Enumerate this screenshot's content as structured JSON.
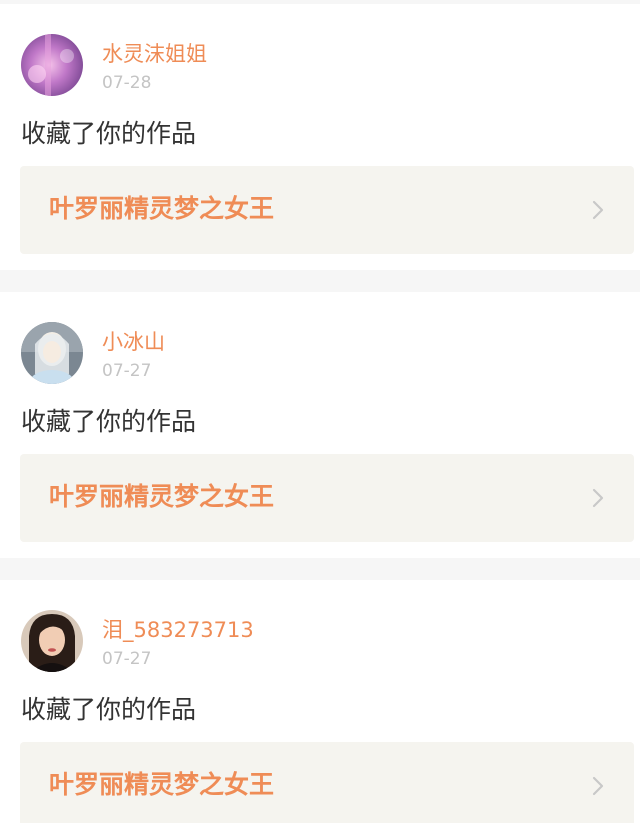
{
  "notifications": [
    {
      "username": "水灵沫姐姐",
      "date": "07-28",
      "action": "收藏了你的作品",
      "work_title": "叶罗丽精灵梦之女王"
    },
    {
      "username": "小冰山",
      "date": "07-27",
      "action": "收藏了你的作品",
      "work_title": "叶罗丽精灵梦之女王"
    },
    {
      "username": "泪_583273713",
      "date": "07-27",
      "action": "收藏了你的作品",
      "work_title": "叶罗丽精灵梦之女王"
    }
  ],
  "colors": {
    "accent": "#ef8c56",
    "date_text": "#c4c4c4",
    "body_text": "#333333",
    "work_card_bg": "#f5f4ef",
    "separator": "#f6f6f6",
    "chevron": "#c8c8c8"
  },
  "icons": {
    "chevron": "chevron-right-icon"
  }
}
